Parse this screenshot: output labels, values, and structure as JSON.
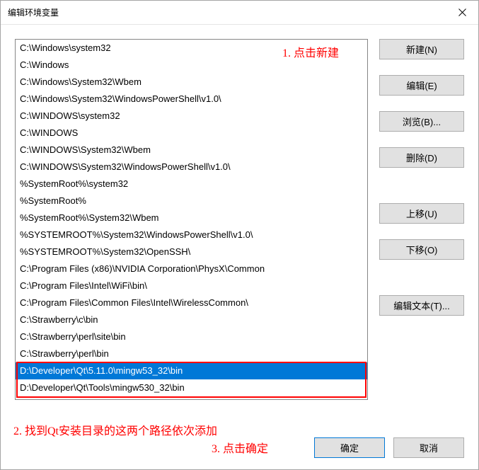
{
  "window": {
    "title": "编辑环境变量"
  },
  "list_items": [
    {
      "text": "C:\\Windows\\system32",
      "selected": false
    },
    {
      "text": "C:\\Windows",
      "selected": false
    },
    {
      "text": "C:\\Windows\\System32\\Wbem",
      "selected": false
    },
    {
      "text": "C:\\Windows\\System32\\WindowsPowerShell\\v1.0\\",
      "selected": false
    },
    {
      "text": "C:\\WINDOWS\\system32",
      "selected": false
    },
    {
      "text": "C:\\WINDOWS",
      "selected": false
    },
    {
      "text": "C:\\WINDOWS\\System32\\Wbem",
      "selected": false
    },
    {
      "text": "C:\\WINDOWS\\System32\\WindowsPowerShell\\v1.0\\",
      "selected": false
    },
    {
      "text": "%SystemRoot%\\system32",
      "selected": false
    },
    {
      "text": "%SystemRoot%",
      "selected": false
    },
    {
      "text": "%SystemRoot%\\System32\\Wbem",
      "selected": false
    },
    {
      "text": "%SYSTEMROOT%\\System32\\WindowsPowerShell\\v1.0\\",
      "selected": false
    },
    {
      "text": "%SYSTEMROOT%\\System32\\OpenSSH\\",
      "selected": false
    },
    {
      "text": "C:\\Program Files (x86)\\NVIDIA Corporation\\PhysX\\Common",
      "selected": false
    },
    {
      "text": "C:\\Program Files\\Intel\\WiFi\\bin\\",
      "selected": false
    },
    {
      "text": "C:\\Program Files\\Common Files\\Intel\\WirelessCommon\\",
      "selected": false
    },
    {
      "text": "C:\\Strawberry\\c\\bin",
      "selected": false
    },
    {
      "text": "C:\\Strawberry\\perl\\site\\bin",
      "selected": false
    },
    {
      "text": "C:\\Strawberry\\perl\\bin",
      "selected": false
    },
    {
      "text": "D:\\Developer\\Qt\\5.11.0\\mingw53_32\\bin",
      "selected": true
    },
    {
      "text": "D:\\Developer\\Qt\\Tools\\mingw530_32\\bin",
      "selected": false
    }
  ],
  "buttons": {
    "new": "新建(N)",
    "edit": "编辑(E)",
    "browse": "浏览(B)...",
    "delete": "删除(D)",
    "move_up": "上移(U)",
    "move_down": "下移(O)",
    "edit_text": "编辑文本(T)...",
    "ok": "确定",
    "cancel": "取消"
  },
  "annotations": {
    "ann1": "1. 点击新建",
    "ann2": "2. 找到Qt安装目录的这两个路径依次添加",
    "ann3": "3. 点击确定"
  }
}
